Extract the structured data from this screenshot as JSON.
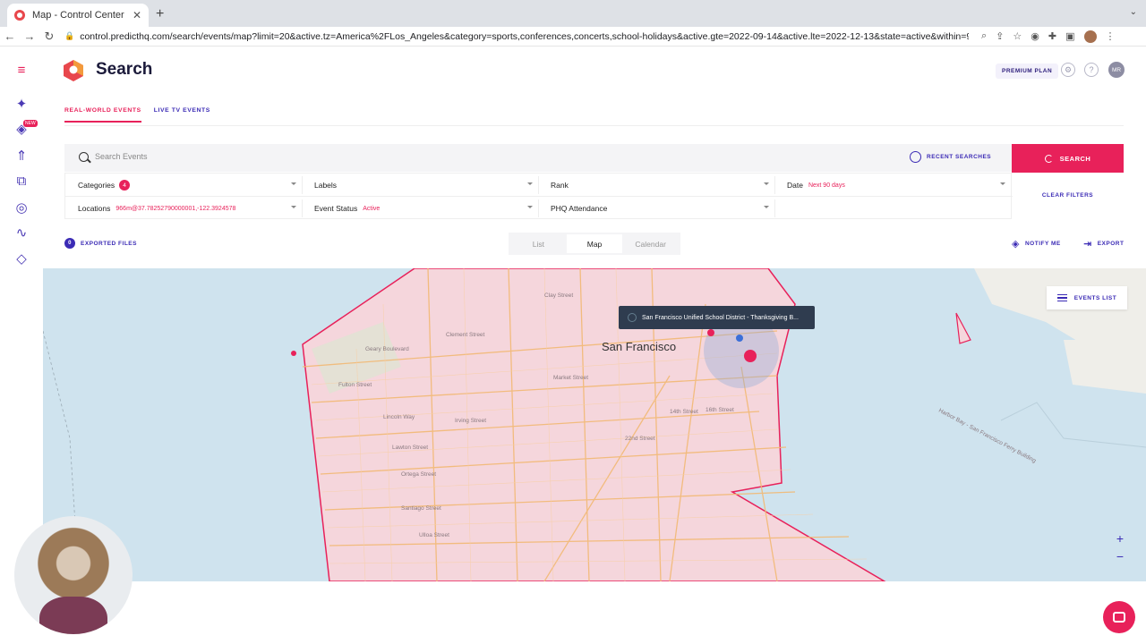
{
  "browser": {
    "tab_title": "Map - Control Center",
    "tab_close": "✕",
    "new_tab": "+",
    "tab_menu": "⌄",
    "url": "control.predicthq.com/search/events/map?limit=20&active.tz=America%2FLos_Angeles&category=sports,conferences,concerts,school-holidays&active.gte=2022-09-14&active.lte=2022-12-13&state=active&within=966m%4..."
  },
  "header": {
    "title": "Search",
    "plan_badge": "PREMIUM PLAN",
    "user_initials": "MR"
  },
  "subtabs": [
    {
      "label": "REAL-WORLD EVENTS",
      "active": true
    },
    {
      "label": "LIVE TV EVENTS",
      "active": false
    }
  ],
  "search": {
    "placeholder": "Search Events",
    "recent_label": "RECENT SEARCHES",
    "button_label": "SEARCH",
    "clear_label": "CLEAR FILTERS"
  },
  "filters": {
    "categories": {
      "label": "Categories",
      "count": "4"
    },
    "labels": {
      "label": "Labels"
    },
    "rank": {
      "label": "Rank"
    },
    "date": {
      "label": "Date",
      "value": "Next 90 days"
    },
    "locations": {
      "label": "Locations",
      "value": "966m@37.78252790000001,-122.3924578"
    },
    "event_status": {
      "label": "Event Status",
      "value": "Active"
    },
    "phq_attendance": {
      "label": "PHQ Attendance"
    }
  },
  "exported": {
    "count": "0",
    "label": "EXPORTED FILES"
  },
  "views": [
    {
      "label": "List",
      "active": false
    },
    {
      "label": "Map",
      "active": true
    },
    {
      "label": "Calendar",
      "active": false
    }
  ],
  "actions": {
    "notify": "NOTIFY ME",
    "export": "EXPORT"
  },
  "map": {
    "city_label": "San Francisco",
    "tooltip": "San Francisco Unified School District - Thanksgiving B...",
    "events_list_label": "EVENTS LIST",
    "zoom_in": "+",
    "zoom_out": "−",
    "street_labels": [
      "Clay Street",
      "Clement Street",
      "Geary Boulevard",
      "Fulton Street",
      "Lincoln Way",
      "Irving Street",
      "Lawton Street",
      "Ortega Street",
      "Santiago Street",
      "Ulloa Street",
      "22nd Street",
      "14th Street",
      "16th Street",
      "Market Street",
      "Harbor Bay - San Francisco Ferry Building"
    ]
  },
  "colors": {
    "accent": "#e8215a",
    "brand": "#3b2bb5",
    "water": "#cfe3ee",
    "land": "#f5d6dc"
  }
}
